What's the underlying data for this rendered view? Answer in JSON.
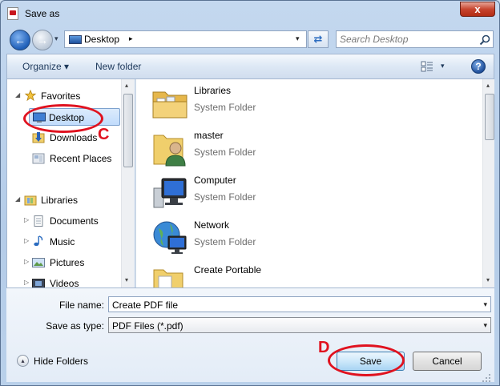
{
  "window": {
    "title": "Save as",
    "close_glyph": "x"
  },
  "address": {
    "location": "Desktop",
    "separator": "▸",
    "history_arrow": "▾",
    "dropdown": "▾",
    "refresh_glyph": "⇄",
    "back_glyph": "←",
    "forward_glyph": "→"
  },
  "search": {
    "placeholder": "Search Desktop"
  },
  "toolbar": {
    "organize_label": "Organize ▾",
    "new_folder_label": "New folder",
    "view_dropdown": "▾",
    "help_glyph": "?"
  },
  "nav_pane": {
    "favorites": {
      "label": "Favorites",
      "items": [
        {
          "label": "Desktop",
          "selected": true
        },
        {
          "label": "Downloads"
        },
        {
          "label": "Recent Places"
        }
      ]
    },
    "libraries": {
      "label": "Libraries",
      "items": [
        {
          "label": "Documents"
        },
        {
          "label": "Music"
        },
        {
          "label": "Pictures"
        },
        {
          "label": "Videos"
        }
      ]
    },
    "expand_open_glyph": "◢",
    "expand_closed_glyph": "▷"
  },
  "content": {
    "items": [
      {
        "name": "Libraries",
        "type": "System Folder",
        "icon": "libraries-folder-icon"
      },
      {
        "name": "master",
        "type": "System Folder",
        "icon": "user-folder-icon"
      },
      {
        "name": "Computer",
        "type": "System Folder",
        "icon": "computer-icon"
      },
      {
        "name": "Network",
        "type": "System Folder",
        "icon": "network-icon"
      },
      {
        "name": "Create Portable",
        "type": "",
        "icon": "folder-icon"
      }
    ]
  },
  "scroll": {
    "up_glyph": "▴",
    "down_glyph": "▾"
  },
  "form": {
    "file_name_label": "File name:",
    "file_name_value": "Create PDF file",
    "save_type_label": "Save as type:",
    "save_type_value": "PDF Files (*.pdf)",
    "dropdown_glyph": "▾"
  },
  "footer": {
    "hide_folders_label": "Hide Folders",
    "hide_folders_glyph": "▴",
    "save_label": "Save",
    "cancel_label": "Cancel"
  },
  "annotations": {
    "letter_c": "C",
    "letter_d": "D",
    "color": "#e0121f"
  },
  "colors": {
    "selection": "#c1dcfc",
    "window_frame": "#b4cce8",
    "close_button": "#c7452f"
  }
}
